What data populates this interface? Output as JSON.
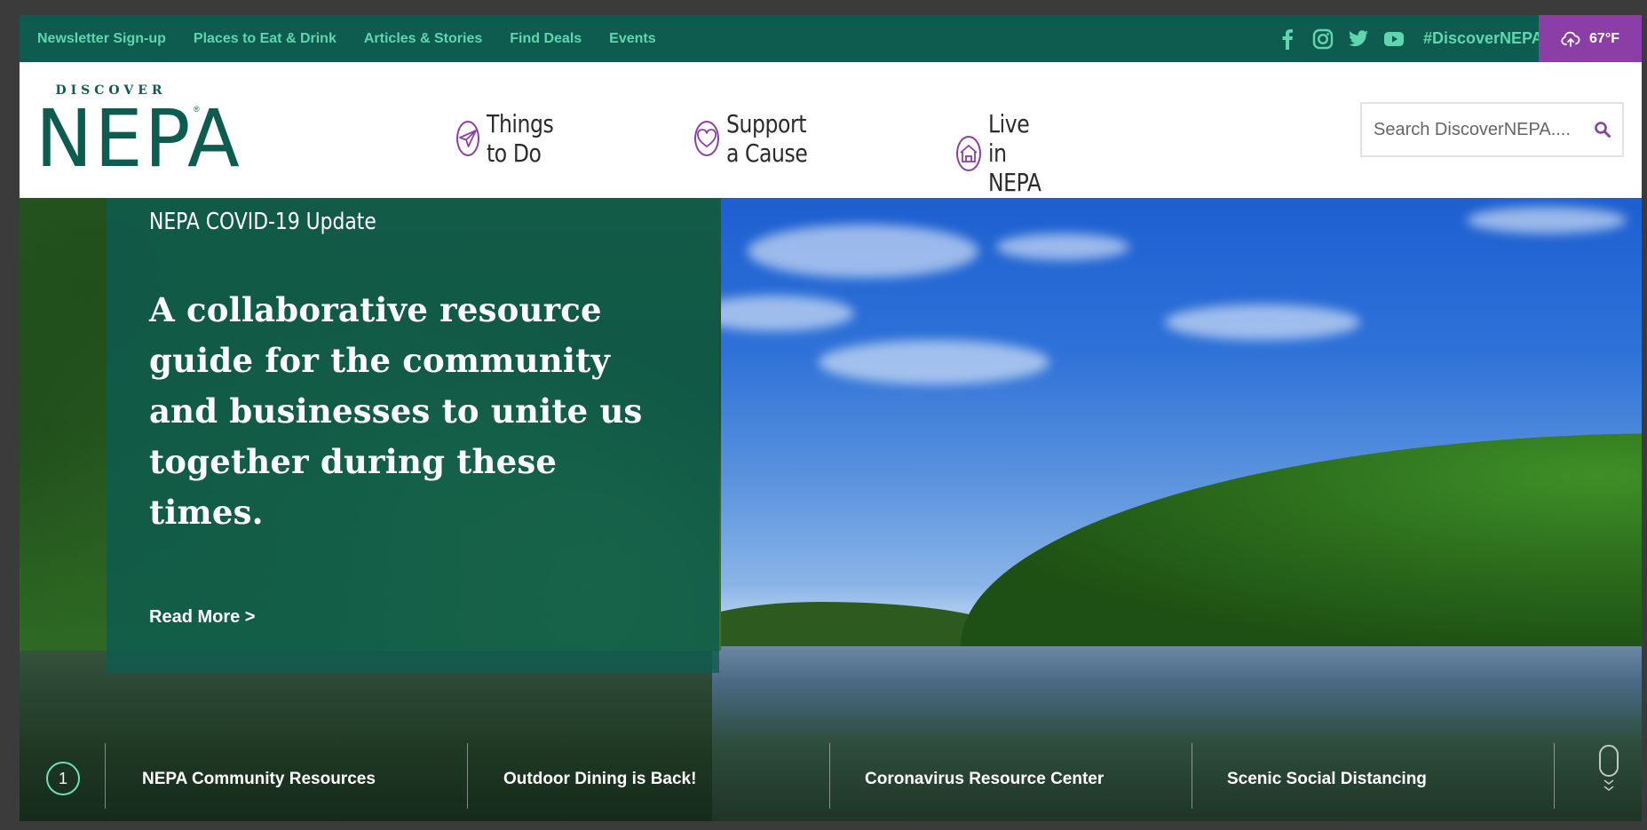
{
  "topbar": {
    "links": [
      "Newsletter Sign-up",
      "Places to Eat & Drink",
      "Articles & Stories",
      "Find Deals",
      "Events"
    ],
    "social_icons": [
      "facebook-icon",
      "instagram-icon",
      "twitter-icon",
      "youtube-icon"
    ],
    "hashtag": "#DiscoverNEPA",
    "weather": {
      "icon": "cloud-upload-icon",
      "temp": "67°F"
    }
  },
  "header": {
    "logo": {
      "top": "DISCOVER",
      "main": "NEPA",
      "mark": "®"
    },
    "nav": [
      {
        "label": "Things to Do",
        "icon": "paper-plane-icon"
      },
      {
        "label": "Support a Cause",
        "icon": "heart-icon"
      },
      {
        "label": "Live in NEPA",
        "icon": "house-icon"
      }
    ],
    "search": {
      "placeholder": "Search DiscoverNEPA....",
      "icon": "search-icon"
    }
  },
  "hero": {
    "kicker": "NEPA COVID-19 Update",
    "headline": "A collaborative resource guide for the community and businesses to unite us together during these times.",
    "cta": "Read More >"
  },
  "quicklinks": {
    "active_number": "1",
    "items": [
      "NEPA Community Resources",
      "Outdoor Dining is Back!",
      "Coronavirus Resource Center",
      "Scenic Social Distancing"
    ]
  },
  "colors": {
    "brand_green": "#0d5c4f",
    "accent_mint": "#6ee0ba",
    "accent_purple": "#8b3fa6"
  }
}
